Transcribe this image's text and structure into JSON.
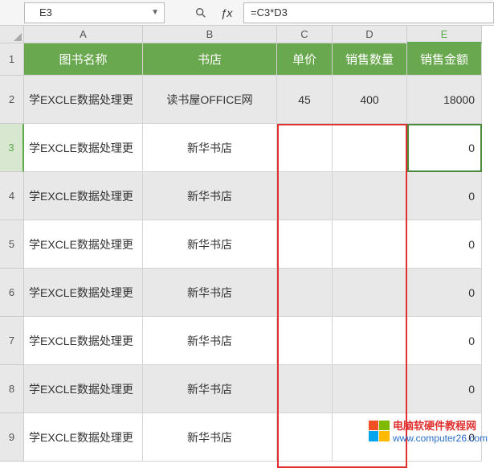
{
  "formula_bar": {
    "name_box": "E3",
    "formula": "=C3*D3"
  },
  "columns": [
    "A",
    "B",
    "C",
    "D",
    "E"
  ],
  "header_row": {
    "n": "1",
    "cells": [
      "图书名称",
      "书店",
      "单价",
      "销售数量",
      "销售金额"
    ]
  },
  "rows": [
    {
      "n": "2",
      "cells": [
        "学EXCLE数据处理更",
        "读书屋OFFICE网",
        "45",
        "400",
        "18000"
      ],
      "even": true
    },
    {
      "n": "3",
      "cells": [
        "学EXCLE数据处理更",
        "新华书店",
        "",
        "",
        "0"
      ],
      "even": false,
      "selected": true
    },
    {
      "n": "4",
      "cells": [
        "学EXCLE数据处理更",
        "新华书店",
        "",
        "",
        "0"
      ],
      "even": true
    },
    {
      "n": "5",
      "cells": [
        "学EXCLE数据处理更",
        "新华书店",
        "",
        "",
        "0"
      ],
      "even": false
    },
    {
      "n": "6",
      "cells": [
        "学EXCLE数据处理更",
        "新华书店",
        "",
        "",
        "0"
      ],
      "even": true
    },
    {
      "n": "7",
      "cells": [
        "学EXCLE数据处理更",
        "新华书店",
        "",
        "",
        "0"
      ],
      "even": false
    },
    {
      "n": "8",
      "cells": [
        "学EXCLE数据处理更",
        "新华书店",
        "",
        "",
        "0"
      ],
      "even": true
    },
    {
      "n": "9",
      "cells": [
        "学EXCLE数据处理更",
        "新华书店",
        "",
        "",
        "0"
      ],
      "even": false
    }
  ],
  "watermark": {
    "line1": "电脑软硬件教程网",
    "line2": "www.computer26.com"
  }
}
